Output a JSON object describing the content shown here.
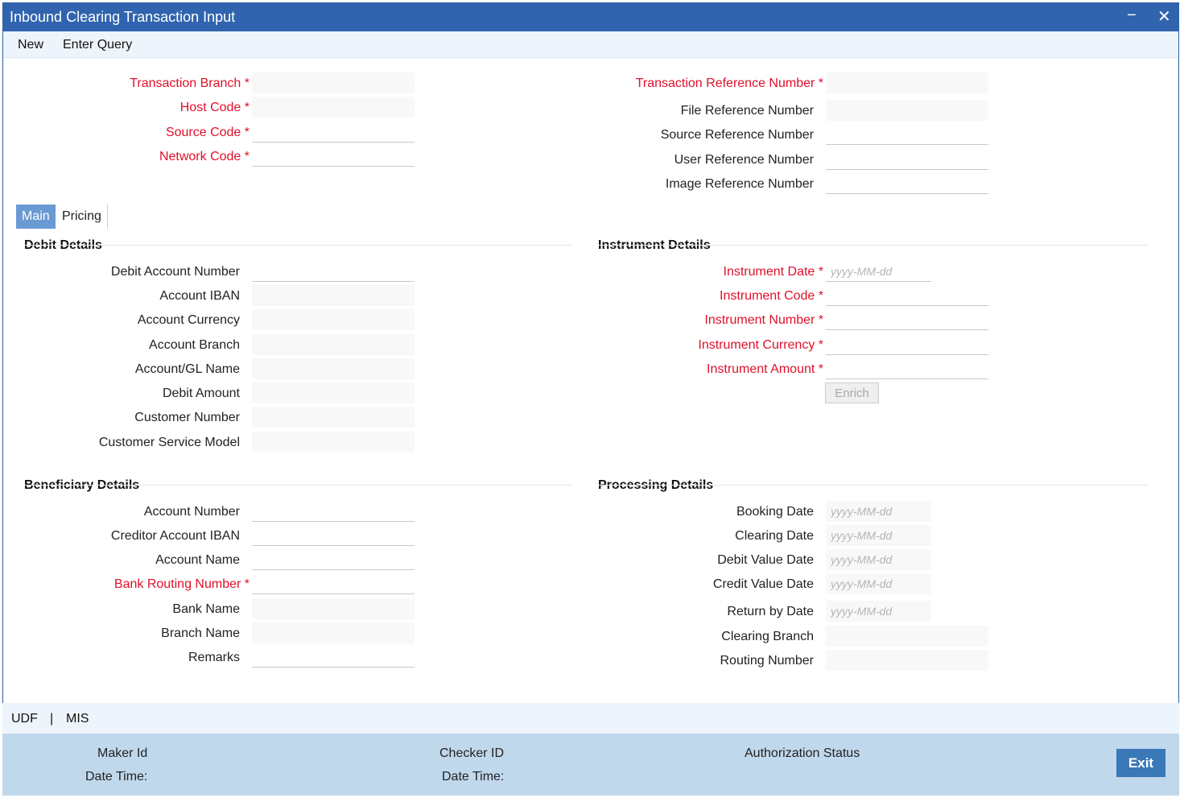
{
  "window": {
    "title": "Inbound Clearing Transaction Input",
    "minimize_glyph": "−",
    "close_glyph": "✕"
  },
  "menu": {
    "new": "New",
    "enter_query": "Enter Query"
  },
  "header": {
    "transaction_branch": "Transaction Branch",
    "host_code": "Host Code",
    "source_code": "Source Code",
    "network_code": "Network Code",
    "transaction_reference_number": "Transaction Reference Number",
    "file_reference_number": "File Reference Number",
    "source_reference_number": "Source Reference Number",
    "user_reference_number": "User Reference Number",
    "image_reference_number": "Image Reference Number"
  },
  "tabs": {
    "main": "Main",
    "pricing": "Pricing"
  },
  "debit": {
    "title": "Debit Details",
    "debit_account_number": "Debit Account Number",
    "account_iban": "Account IBAN",
    "account_currency": "Account Currency",
    "account_branch": "Account Branch",
    "account_gl_name": "Account/GL Name",
    "debit_amount": "Debit Amount",
    "customer_number": "Customer Number",
    "customer_service_model": "Customer Service Model"
  },
  "instrument": {
    "title": "Instrument Details",
    "instrument_date": "Instrument Date",
    "instrument_code": "Instrument Code",
    "instrument_number": "Instrument Number",
    "instrument_currency": "Instrument Currency",
    "instrument_amount": "Instrument Amount",
    "enrich": "Enrich"
  },
  "beneficiary": {
    "title": "Beneficiary Details",
    "account_number": "Account Number",
    "creditor_account_iban": "Creditor Account IBAN",
    "account_name": "Account Name",
    "bank_routing_number": "Bank Routing Number",
    "bank_name": "Bank Name",
    "branch_name": "Branch Name",
    "remarks": "Remarks"
  },
  "processing": {
    "title": "Processing Details",
    "booking_date": "Booking Date",
    "clearing_date": "Clearing Date",
    "debit_value_date": "Debit Value Date",
    "credit_value_date": "Credit Value Date",
    "return_by_date": "Return by Date",
    "clearing_branch": "Clearing Branch",
    "routing_number": "Routing Number"
  },
  "date_placeholder": "yyyy-MM-dd",
  "bottom_links": {
    "udf": "UDF",
    "separator": "|",
    "mis": "MIS"
  },
  "footer": {
    "maker_id": "Maker Id",
    "maker_date_time": "Date Time:",
    "checker_id": "Checker ID",
    "checker_date_time": "Date Time:",
    "authorization_status": "Authorization Status",
    "exit": "Exit"
  }
}
